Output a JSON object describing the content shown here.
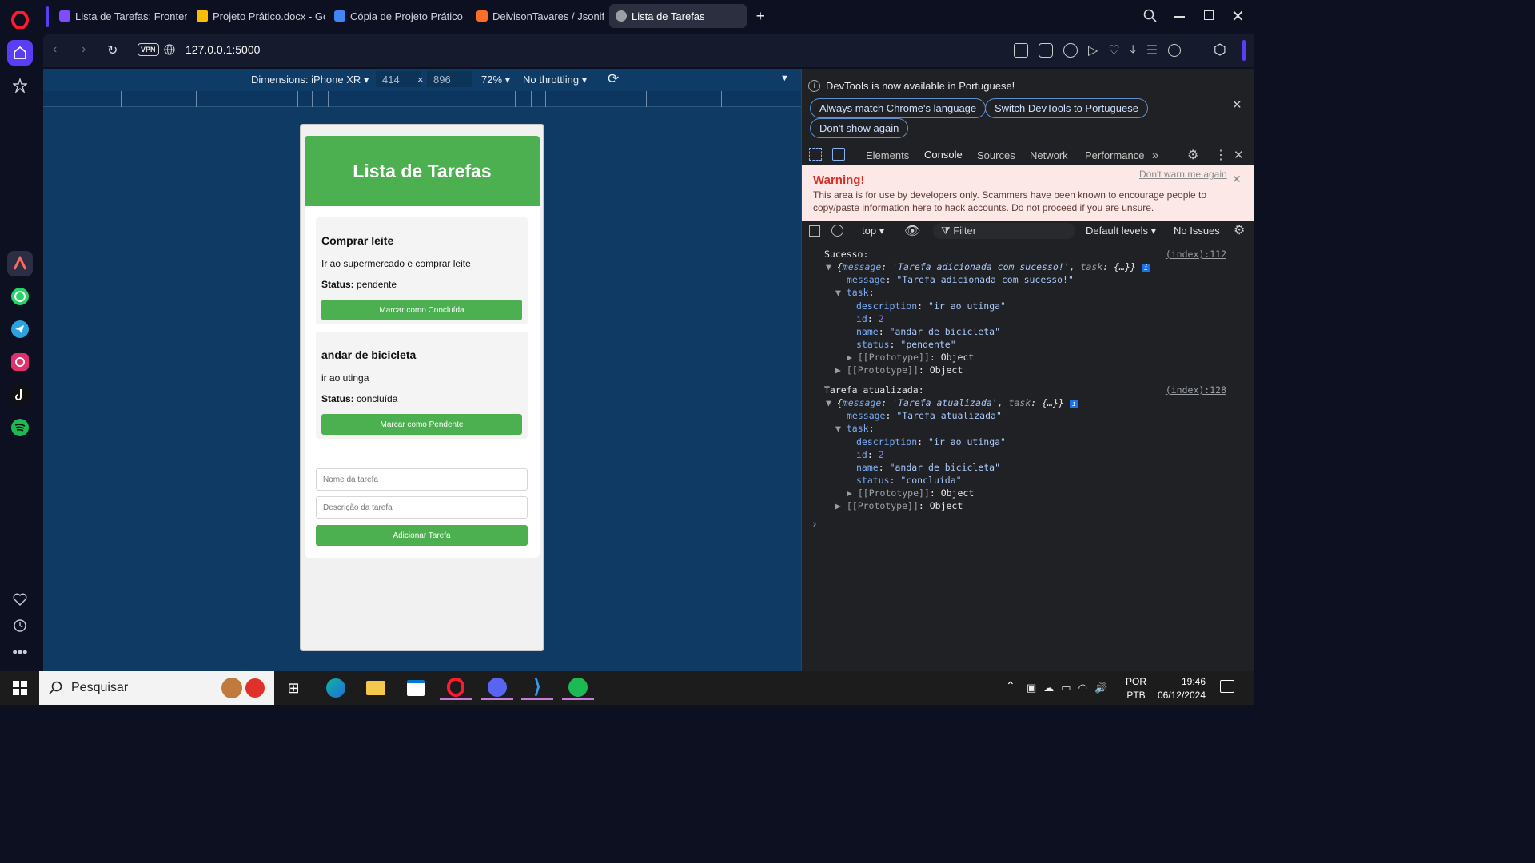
{
  "browser": {
    "tabs": [
      {
        "label": "Lista de Tarefas: Frontend",
        "color": "#7c4dff"
      },
      {
        "label": "Projeto Prático.docx - Goo",
        "color": "#fbbc04"
      },
      {
        "label": "Cópia de Projeto Prático.d",
        "color": "#4285f4"
      },
      {
        "label": "DeivisonTavares / Jsonify",
        "color": "#fc6d26"
      },
      {
        "label": "Lista de Tarefas",
        "color": "#9aa0a6"
      }
    ],
    "vpn_label": "VPN",
    "url": "127.0.0.1:5000"
  },
  "device_toolbar": {
    "dimensions_label": "Dimensions: iPhone XR",
    "width": "414",
    "x_sep": "×",
    "height": "896",
    "zoom": "72%",
    "throttling": "No throttling"
  },
  "app": {
    "title": "Lista de Tarefas",
    "status_label": "Status:",
    "tasks": [
      {
        "name": "Comprar leite",
        "description": "Ir ao supermercado e comprar leite",
        "status": "pendente",
        "button": "Marcar como Concluída"
      },
      {
        "name": "andar de bicicleta",
        "description": "ir ao utinga",
        "status": "concluída",
        "button": "Marcar como Pendente"
      }
    ],
    "name_placeholder": "Nome da tarefa",
    "desc_placeholder": "Descrição da tarefa",
    "add_button": "Adicionar Tarefa"
  },
  "devtools": {
    "infobar_text": "DevTools is now available in Portuguese!",
    "btn_match": "Always match Chrome's language",
    "btn_switch": "Switch DevTools to Portuguese",
    "btn_dont_show": "Don't show again",
    "tabs": [
      "Elements",
      "Console",
      "Sources",
      "Network",
      "Performance"
    ],
    "active_tab": "Console",
    "warning_title": "Warning!",
    "dont_warn": "Don't warn me again",
    "warning_text": "This area is for use by developers only. Scammers have been known to encourage people to copy/paste information here to hack accounts. Do not proceed if you are unsure.",
    "context": "top",
    "filter": "Filter",
    "levels": "Default levels",
    "issues": "No Issues",
    "log1": {
      "label": "Sucesso:",
      "source": "(index):112",
      "summary_message": "'Tarefa adicionada com sucesso!'",
      "message": "\"Tarefa adicionada com sucesso!\"",
      "description": "\"ir ao utinga\"",
      "id": "2",
      "name": "\"andar de bicicleta\"",
      "status": "\"pendente\""
    },
    "log2": {
      "label": "Tarefa atualizada:",
      "source": "(index):128",
      "summary_message": "'Tarefa atualizada'",
      "message": "\"Tarefa atualizada\"",
      "description": "\"ir ao utinga\"",
      "id": "2",
      "name": "\"andar de bicicleta\"",
      "status": "\"concluída\""
    },
    "keys": {
      "message": "message",
      "task": "task",
      "description": "description",
      "id": "id",
      "name": "name",
      "status": "status",
      "prototype": "[[Prototype]]",
      "object": "Object",
      "ellipsis": "{…}"
    }
  },
  "taskbar": {
    "search": "Pesquisar",
    "lang_top": "POR",
    "lang_bottom": "PTB",
    "time": "19:46",
    "date": "06/12/2024"
  }
}
